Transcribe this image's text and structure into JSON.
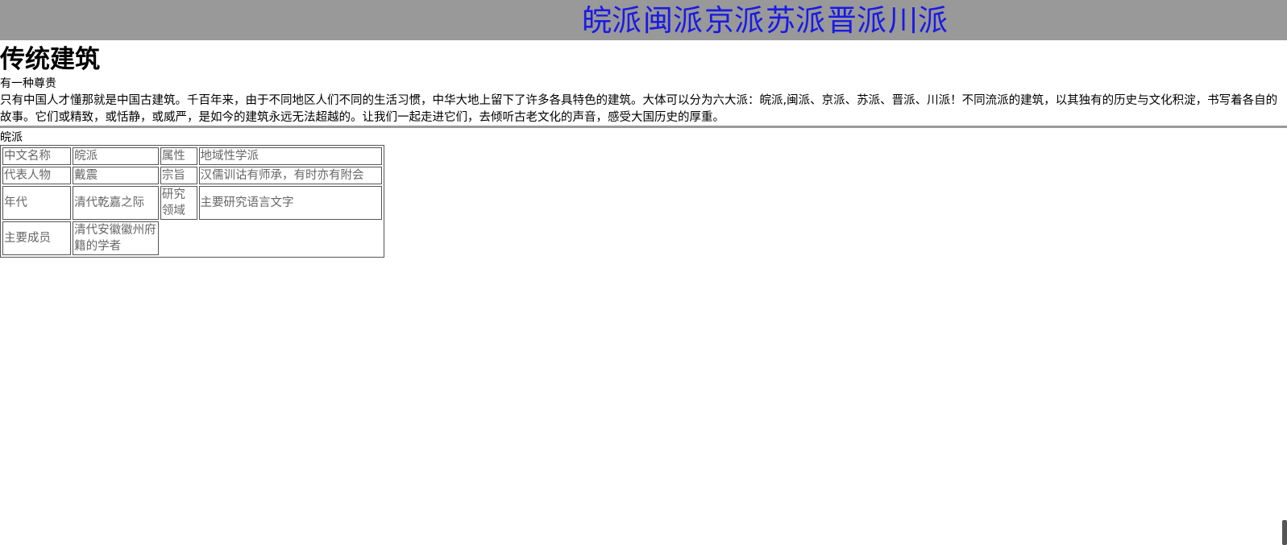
{
  "nav": {
    "items": [
      "皖派",
      "闽派",
      "京派",
      "苏派",
      "晋派",
      "川派"
    ]
  },
  "header": {
    "title": "传统建筑",
    "subtitle": "有一种尊贵"
  },
  "intro": {
    "text": "只有中国人才懂那就是中国古建筑。千百年来，由于不同地区人们不同的生活习惯，中华大地上留下了许多各具特色的建筑。大体可以分为六大派：皖派,闽派、京派、苏派、晋派、川派！不同流派的建筑，以其独有的历史与文化积淀，书写着各自的故事。它们或精致，或恬静，或威严，是如今的建筑永远无法超越的。让我们一起走进它们，去倾听古老文化的声音，感受大国历史的厚重。"
  },
  "section": {
    "label": "皖派"
  },
  "table": {
    "rows": [
      [
        "中文名称",
        "皖派",
        "属性",
        "地域性学派"
      ],
      [
        "代表人物",
        "戴震",
        "宗旨",
        "汉儒训诂有师承，有时亦有附会"
      ],
      [
        "年代",
        "清代乾嘉之际",
        "研究领域",
        "主要研究语言文字"
      ],
      [
        "主要成员",
        "清代安徽徽州府籍的学者"
      ]
    ]
  },
  "colors": {
    "topbar_bg": "#999999",
    "nav_link": "#1a1ae6",
    "table_text": "#666666"
  }
}
